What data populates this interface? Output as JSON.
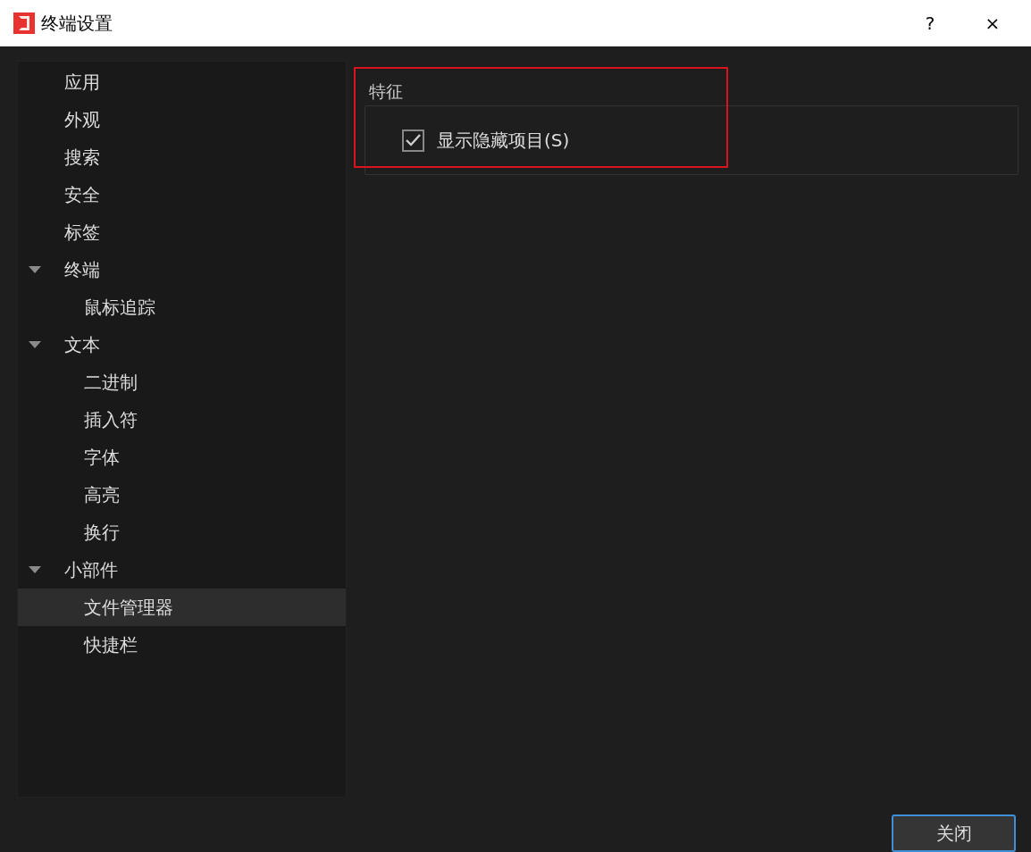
{
  "window": {
    "title": "终端设置",
    "help_button": "?",
    "close_button": "×"
  },
  "sidebar": {
    "items": [
      {
        "label": "应用",
        "selected": false
      },
      {
        "label": "外观",
        "selected": false
      },
      {
        "label": "搜索",
        "selected": false
      },
      {
        "label": "安全",
        "selected": false
      },
      {
        "label": "标签",
        "selected": false
      },
      {
        "label": "终端",
        "selected": false,
        "expanded": true,
        "children": [
          {
            "label": "鼠标追踪",
            "selected": false
          }
        ]
      },
      {
        "label": "文本",
        "selected": false,
        "expanded": true,
        "children": [
          {
            "label": "二进制",
            "selected": false
          },
          {
            "label": "插入符",
            "selected": false
          },
          {
            "label": "字体",
            "selected": false
          },
          {
            "label": "高亮",
            "selected": false
          },
          {
            "label": "换行",
            "selected": false
          }
        ]
      },
      {
        "label": "小部件",
        "selected": false,
        "expanded": true,
        "children": [
          {
            "label": "文件管理器",
            "selected": true
          },
          {
            "label": "快捷栏",
            "selected": false
          }
        ]
      }
    ]
  },
  "group": {
    "title": "特征",
    "options": [
      {
        "label": "显示隐藏项目(S)",
        "checked": true
      }
    ]
  },
  "buttons": [
    {
      "label": "关闭"
    }
  ]
}
